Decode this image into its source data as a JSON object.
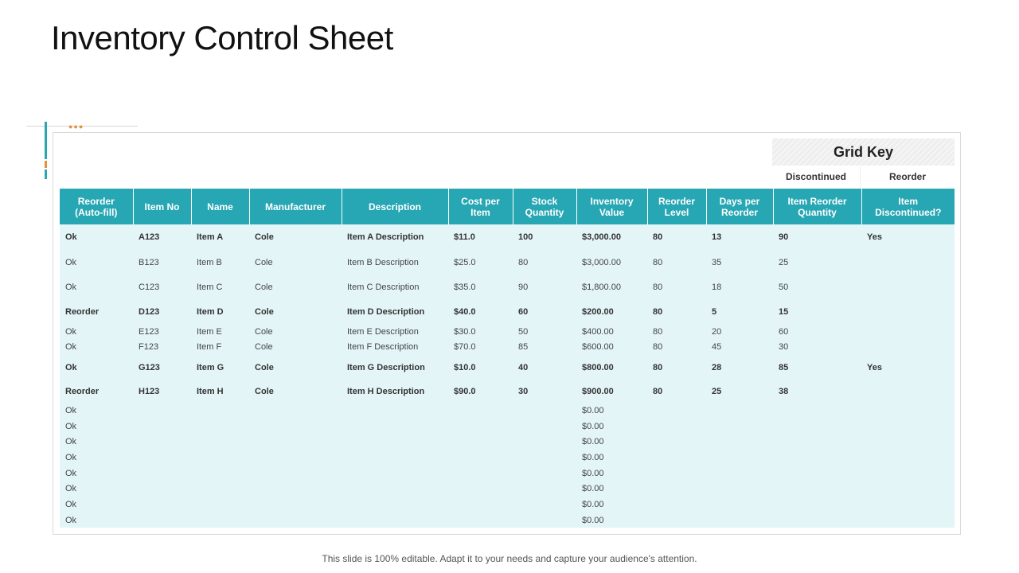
{
  "title": "Inventory Control Sheet",
  "grid_key": {
    "title": "Grid Key",
    "items": [
      "Discontinued",
      "Reorder"
    ]
  },
  "table": {
    "headers": [
      "Reorder\n(Auto-fill)",
      "Item No",
      "Name",
      "Manufacturer",
      "Description",
      "Cost per\nItem",
      "Stock\nQuantity",
      "Inventory\nValue",
      "Reorder\nLevel",
      "Days per\nReorder",
      "Item Reorder\nQuantity",
      "Item\nDiscontinued?"
    ],
    "rows": [
      [
        "Ok",
        "A123",
        "Item A",
        "Cole",
        "Item A Description",
        "$11.0",
        "100",
        "$3,000.00",
        "80",
        "13",
        "90",
        "Yes"
      ],
      [
        "Ok",
        "B123",
        "Item B",
        "Cole",
        "Item B Description",
        "$25.0",
        "80",
        "$3,000.00",
        "80",
        "35",
        "25",
        ""
      ],
      [
        "Ok",
        "C123",
        "Item C",
        "Cole",
        "Item C Description",
        "$35.0",
        "90",
        "$1,800.00",
        "80",
        "18",
        "50",
        ""
      ],
      [
        "Reorder",
        "D123",
        "Item D",
        "Cole",
        "Item D Description",
        "$40.0",
        "60",
        "$200.00",
        "80",
        "5",
        "15",
        ""
      ],
      [
        "Ok",
        "E123",
        "Item E",
        "Cole",
        "Item E Description",
        "$30.0",
        "50",
        "$400.00",
        "80",
        "20",
        "60",
        ""
      ],
      [
        "Ok",
        "F123",
        "Item F",
        "Cole",
        "Item F Description",
        "$70.0",
        "85",
        "$600.00",
        "80",
        "45",
        "30",
        ""
      ],
      [
        "Ok",
        "G123",
        "Item G",
        "Cole",
        "Item G Description",
        "$10.0",
        "40",
        "$800.00",
        "80",
        "28",
        "85",
        "Yes"
      ],
      [
        "Reorder",
        "H123",
        "Item H",
        "Cole",
        "Item H Description",
        "$90.0",
        "30",
        "$900.00",
        "80",
        "25",
        "38",
        ""
      ],
      [
        "Ok",
        "",
        "",
        "",
        "",
        "",
        "",
        "$0.00",
        "",
        "",
        "",
        ""
      ],
      [
        "Ok",
        "",
        "",
        "",
        "",
        "",
        "",
        "$0.00",
        "",
        "",
        "",
        ""
      ],
      [
        "Ok",
        "",
        "",
        "",
        "",
        "",
        "",
        "$0.00",
        "",
        "",
        "",
        ""
      ],
      [
        "Ok",
        "",
        "",
        "",
        "",
        "",
        "",
        "$0.00",
        "",
        "",
        "",
        ""
      ],
      [
        "Ok",
        "",
        "",
        "",
        "",
        "",
        "",
        "$0.00",
        "",
        "",
        "",
        ""
      ],
      [
        "Ok",
        "",
        "",
        "",
        "",
        "",
        "",
        "$0.00",
        "",
        "",
        "",
        ""
      ],
      [
        "Ok",
        "",
        "",
        "",
        "",
        "",
        "",
        "$0.00",
        "",
        "",
        "",
        ""
      ],
      [
        "Ok",
        "",
        "",
        "",
        "",
        "",
        "",
        "$0.00",
        "",
        "",
        "",
        ""
      ]
    ],
    "bold_rows": [
      0,
      3,
      6,
      7
    ]
  },
  "footer": "This slide is 100% editable. Adapt it to your needs and capture your audience's attention.",
  "colors": {
    "header_teal": "#27a6b3",
    "row_bg": "#e4f5f8",
    "accent_orange": "#e4913a"
  }
}
